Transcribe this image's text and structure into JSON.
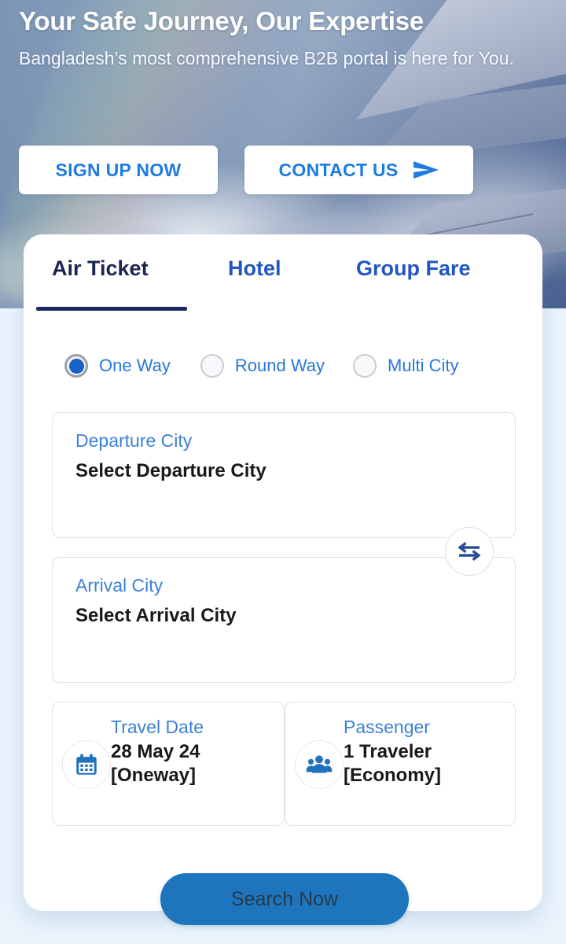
{
  "hero": {
    "title": "Your Safe Journey, Our Expertise",
    "subtitle": "Bangladesh’s most comprehensive B2B portal is here for You.",
    "signup_label": "SIGN UP NOW",
    "contact_label": "CONTACT US",
    "contact_icon": "send-icon",
    "background_image": "airplane-wing-above-clouds"
  },
  "booking": {
    "tabs": [
      {
        "label": "Air Ticket",
        "active": true
      },
      {
        "label": "Hotel",
        "active": false
      },
      {
        "label": "Group Fare",
        "active": false
      }
    ],
    "trip_types": [
      {
        "label": "One Way",
        "selected": true
      },
      {
        "label": "Round Way",
        "selected": false
      },
      {
        "label": "Multi City",
        "selected": false
      }
    ],
    "departure": {
      "label": "Departure City",
      "value": "Select Departure City",
      "placeholder": "Select Departure City"
    },
    "arrival": {
      "label": "Arrival City",
      "value": "Select Arrival City",
      "placeholder": "Select Arrival City"
    },
    "swap_icon": "swap-horizontal-icon",
    "travel_date": {
      "label": "Travel Date",
      "value": "28 May 24 [Oneway]",
      "icon": "calendar-icon"
    },
    "passenger": {
      "label": "Passenger",
      "value": "1 Traveler [Economy]",
      "icon": "people-group-icon"
    },
    "search_label": "Search Now"
  },
  "colors": {
    "accent_blue": "#2256c4",
    "link_blue": "#3b82d8",
    "active_tab_navy": "#1b2550",
    "radio_selected": "#1961c4",
    "search_button": "#1e74bd",
    "page_background": "#e9f3fc",
    "icon_blue": "#2072bd"
  }
}
